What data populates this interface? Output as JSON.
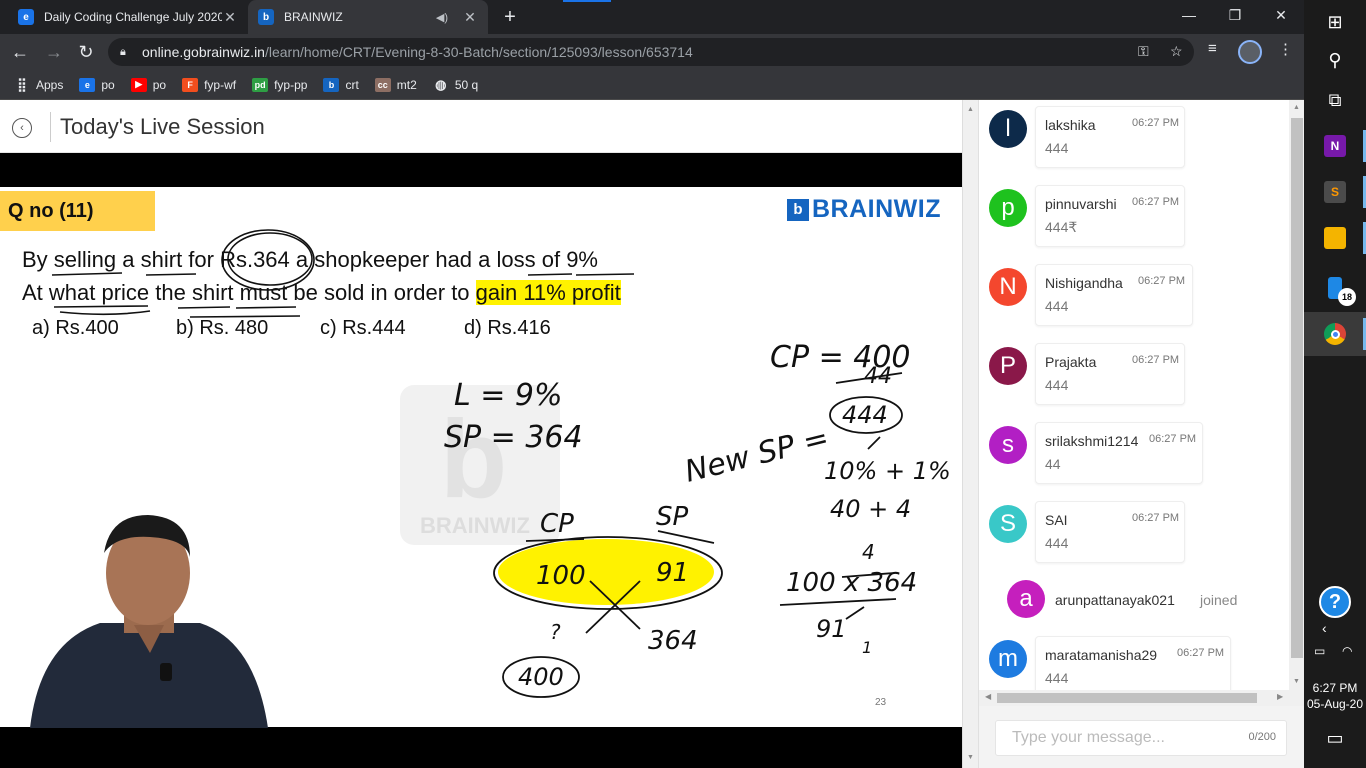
{
  "browser": {
    "tabs": [
      {
        "title": "Daily Coding Challenge July 2020",
        "favicon": "e-icon",
        "active": false
      },
      {
        "title": "BRAINWIZ",
        "favicon": "brainwiz-icon",
        "active": true
      }
    ],
    "url_host": "online.gobrainwiz.in",
    "url_path": "/learn/home/CRT/Evening-8-30-Batch/section/125093/lesson/653714",
    "bookmarks": [
      {
        "label": "Apps",
        "icon": "apps-grid-icon",
        "color": "#e8eaed"
      },
      {
        "label": "po",
        "icon": "e-icon",
        "color": "#1a73e8"
      },
      {
        "label": "po",
        "icon": "youtube-icon",
        "color": "#ff0000"
      },
      {
        "label": "fyp-wf",
        "icon": "figma-icon",
        "color": "#f24e1e"
      },
      {
        "label": "fyp-pp",
        "icon": "pd-icon",
        "color": "#2e9e44"
      },
      {
        "label": "crt",
        "icon": "brainwiz-icon",
        "color": "#1565c0"
      },
      {
        "label": "mt2",
        "icon": "cc-icon",
        "color": "#8d6e63"
      },
      {
        "label": "50 q",
        "icon": "globe-icon",
        "color": "#e8eaed"
      }
    ]
  },
  "page": {
    "title": "Today's Live Session"
  },
  "slide": {
    "qno": "Q no (11)",
    "brand": "BRAINWIZ",
    "line1_a": "By selling a shirt for Rs.364 a shopkeeper had a loss of 9%",
    "line2_a": "At what price the shirt must be sold in order to ",
    "line2_b": "gain 11% profit",
    "options": [
      "a) Rs.400",
      "b) Rs. 480",
      "c) Rs.444",
      "d) Rs.416"
    ],
    "slide_number": "23",
    "watermark": "BRAINWIZ",
    "handwriting": {
      "l_eq": "L = 9%",
      "sp_eq": "SP = 364",
      "cp_label": "CP",
      "sp_label": "SP",
      "cp_val": "100",
      "sp_val": "91",
      "left_small": "?",
      "right_small": "364",
      "answer": "400",
      "cp_result": "CP = 400",
      "n44": "44",
      "new_sp": "New SP =",
      "n444": "444",
      "pct": "10% + 1%",
      "sum": "40 + 4",
      "frac_top_small": "4",
      "frac_num": "100 x 364",
      "frac_den": "91",
      "frac_den_small": "1"
    }
  },
  "chat": {
    "messages": [
      {
        "initial": "l",
        "name": "lakshika",
        "time": "06:27 PM",
        "text": "444",
        "color": "#0d2a4a"
      },
      {
        "initial": "p",
        "name": "pinnuvarshi",
        "time": "06:27 PM",
        "text": "444₹",
        "color": "#1ec21e"
      },
      {
        "initial": "N",
        "name": "Nishigandha",
        "time": "06:27 PM",
        "text": "444",
        "color": "#f4472e"
      },
      {
        "initial": "P",
        "name": "Prajakta",
        "time": "06:27 PM",
        "text": "444",
        "color": "#8a1849"
      },
      {
        "initial": "s",
        "name": "srilakshmi1214",
        "time": "06:27 PM",
        "text": "44",
        "color": "#b21fc4"
      },
      {
        "initial": "S",
        "name": "SAI",
        "time": "06:27 PM",
        "text": "444",
        "color": "#39c8c8"
      }
    ],
    "joined": {
      "initial": "a",
      "name": "arunpattanayak021",
      "status": "joined"
    },
    "last_message": {
      "initial": "m",
      "name": "maratamanisha29",
      "time": "06:27 PM",
      "text": "444",
      "color": "#1e7be0"
    },
    "input_placeholder": "Type your message...",
    "char_count": "0/200"
  },
  "taskbar": {
    "time": "6:27 PM",
    "date": "05-Aug-20",
    "badge": "18"
  }
}
